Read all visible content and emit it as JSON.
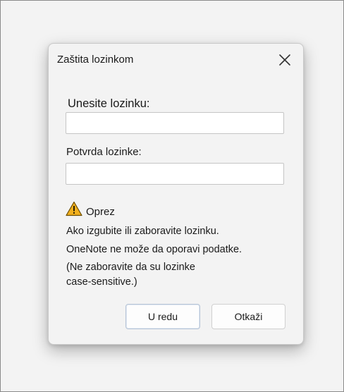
{
  "dialog": {
    "title": "Zaštita lozinkom",
    "password_label": "Unesite lozinku:",
    "password_value": "",
    "confirm_label": "Potvrda lozinke:",
    "confirm_value": "",
    "warning": {
      "icon": "warning-triangle-icon",
      "title": "Oprez",
      "lines": [
        "Ako izgubite ili zaboravite lozinku.",
        "OneNote ne može da oporavi podatke.",
        "(Ne zaboravite da su lozinke",
        "case-sensitive.)"
      ]
    },
    "ok_label": "U redu",
    "cancel_label": "Otkaži"
  },
  "colors": {
    "warning_fill": "#f2b01e",
    "warning_stroke": "#6b4c00"
  }
}
